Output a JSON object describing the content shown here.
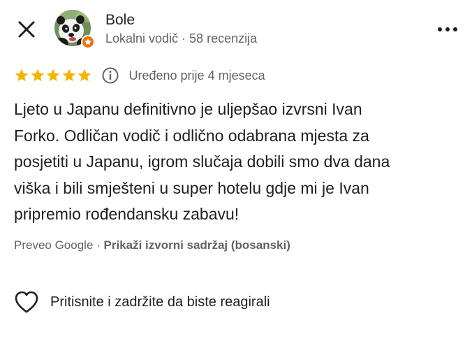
{
  "header": {
    "close_icon": "close-icon",
    "more_icon": "more-vertical-dots-icon",
    "author": {
      "name": "Bole",
      "meta": "Lokalni vodič · 58 recenzija",
      "avatar_icon": "panda-avatar",
      "badge_icon": "local-guide-star-icon",
      "badge_color": "#e8710a"
    }
  },
  "review": {
    "rating": 5,
    "rating_max": 5,
    "star_color": "#f4b400",
    "info_icon": "info-icon",
    "edited_label": "Uređeno prije 4 mjeseca",
    "text": "Ljeto u Japanu definitivno je uljepšao izvrsni Ivan\nForko. Odličan vodič i odlično odabrana mjesta za\nposjetiti u Japanu, igrom slučaja dobili smo dva dana\nviška i bili smješteni u super hotelu gdje mi je Ivan\npripremio rođendansku zabavu!",
    "translated_by": "Preveo Google · ",
    "show_original": "Prikaži izvorni sadržaj (bosanski)"
  },
  "reactions": {
    "heart_icon": "heart-outline-icon",
    "label": "Pritisnite i zadržite da biste reagirali"
  }
}
